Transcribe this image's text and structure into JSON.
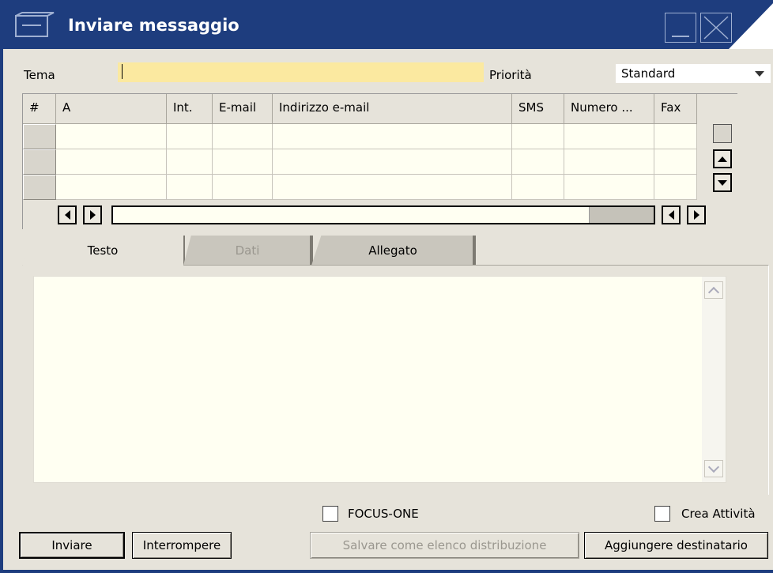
{
  "window": {
    "title": "Inviare messaggio",
    "title_color": "#1e3d7e"
  },
  "form": {
    "tema_label": "Tema",
    "tema_value": "",
    "priorita_label": "Priorità",
    "priorita_value": "Standard"
  },
  "grid": {
    "columns": [
      "#",
      "A",
      "Int.",
      "E-mail",
      "Indirizzo e-mail",
      "SMS",
      "Numero ...",
      "Fax"
    ],
    "rows": [
      [
        "",
        "",
        "",
        "",
        "",
        "",
        ""
      ],
      [
        "",
        "",
        "",
        "",
        "",
        "",
        ""
      ],
      [
        "",
        "",
        "",
        "",
        "",
        "",
        ""
      ]
    ]
  },
  "tabs": [
    {
      "label": "Testo",
      "active": true
    },
    {
      "label": "Dati",
      "disabled": true
    },
    {
      "label": "Allegato"
    }
  ],
  "message_body": "",
  "checkboxes": {
    "focus_one": {
      "label": "FOCUS-ONE",
      "checked": false
    },
    "crea_attivita": {
      "label": "Crea Attività",
      "checked": false
    }
  },
  "buttons": {
    "send": "Inviare",
    "abort": "Interrompere",
    "save_list": "Salvare come elenco distribuzione",
    "add_recipient": "Aggiungere destinatario"
  },
  "colors": {
    "accent": "#1e3d7e",
    "field_highlight": "#fbe9a0",
    "window_bg": "#e6e3da"
  }
}
